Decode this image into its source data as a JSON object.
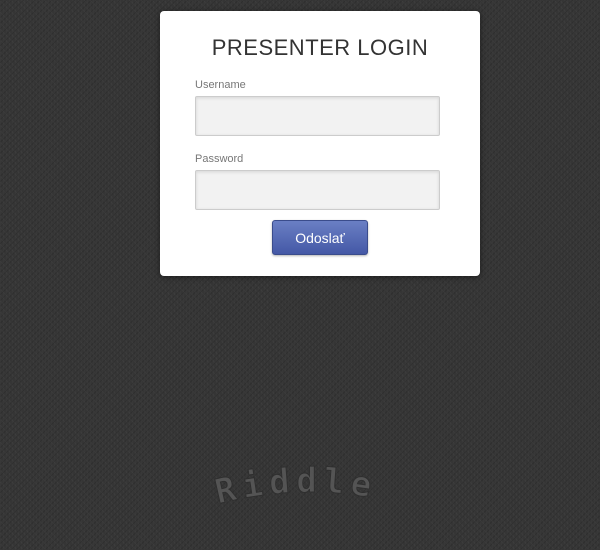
{
  "login": {
    "title": "PRESENTER LOGIN",
    "username_label": "Username",
    "username_value": "",
    "password_label": "Password",
    "password_value": "",
    "submit_label": "Odoslať"
  },
  "footer": {
    "logo_text": "Riddle"
  },
  "colors": {
    "background": "#353535",
    "card": "#ffffff",
    "button_top": "#6a7fc4",
    "button_bottom": "#4458a6"
  }
}
